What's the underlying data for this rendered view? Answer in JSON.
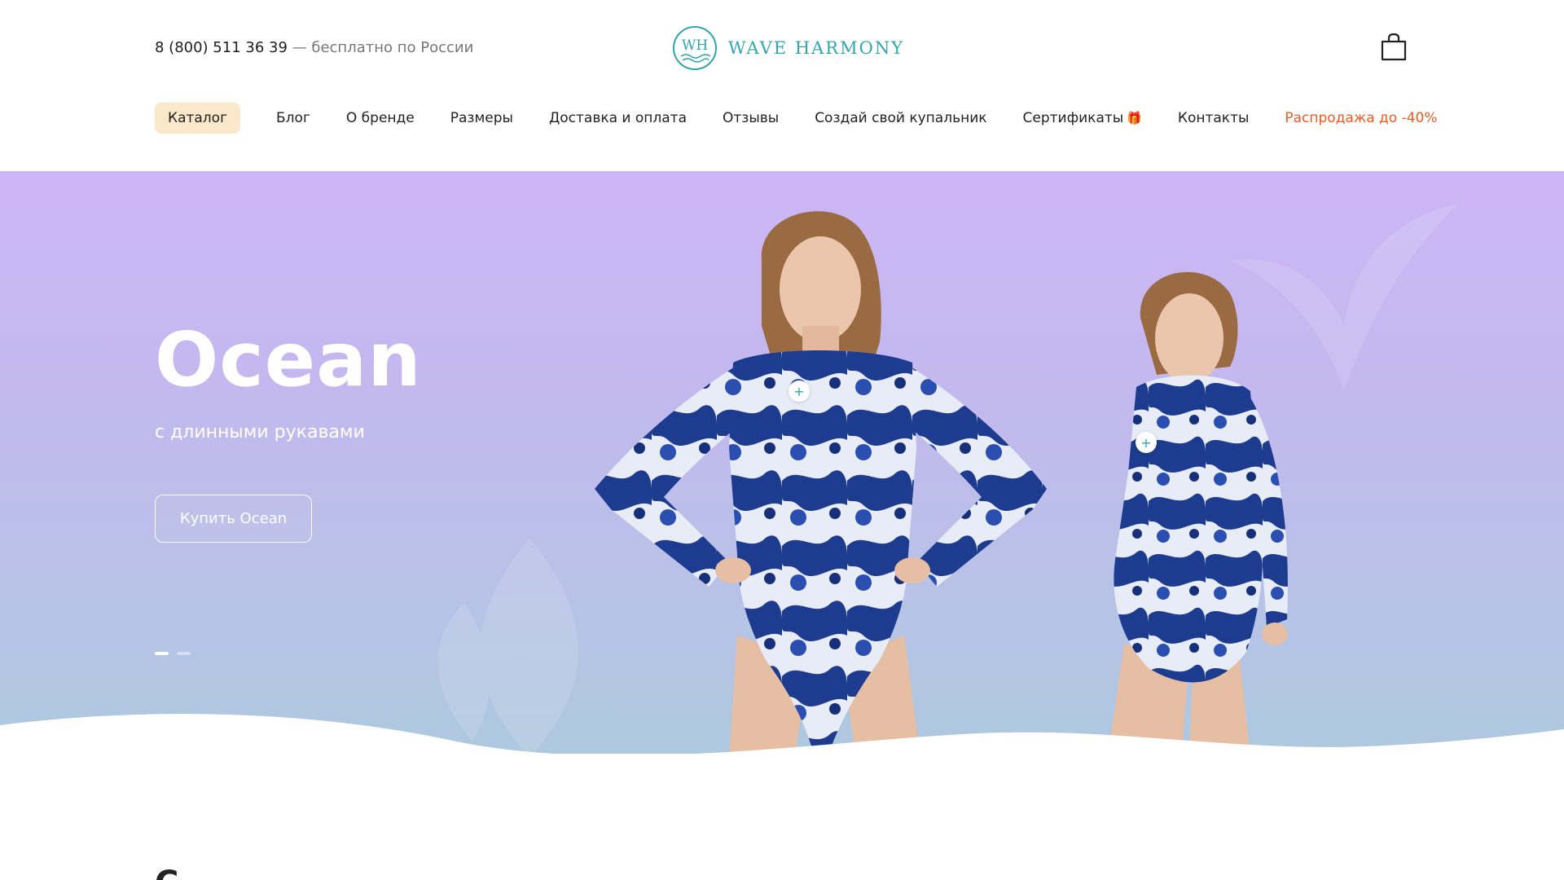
{
  "header": {
    "phone_number": "8 (800) 511 36 39",
    "phone_note": "— бесплатно по России",
    "logo_monogram": "WH",
    "logo_text": "WAVE HARMONY"
  },
  "nav": {
    "items": [
      {
        "label": "Каталог"
      },
      {
        "label": "Блог"
      },
      {
        "label": "О бренде"
      },
      {
        "label": "Размеры"
      },
      {
        "label": "Доставка и оплата"
      },
      {
        "label": "Отзывы"
      },
      {
        "label": "Создай свой купальник"
      },
      {
        "label": "Сертификаты"
      },
      {
        "label": "Контакты"
      },
      {
        "label": "Распродажа до -40%"
      }
    ],
    "gift_icon": "gift-icon"
  },
  "hero": {
    "title": "Ocean",
    "subtitle": "с длинными рукавами",
    "button_label": "Купить Ocean",
    "hotspot_symbol": "+",
    "slides_total": 2,
    "slide_active": 1
  },
  "below": {
    "partial_heading_glyph": "С"
  },
  "colors": {
    "brand": "#2fa7ac",
    "sale": "#ef5a23",
    "catalog_bg": "#fbe7c9",
    "hero_top": "#cdb6f6",
    "hero_bottom": "#aec8df"
  }
}
